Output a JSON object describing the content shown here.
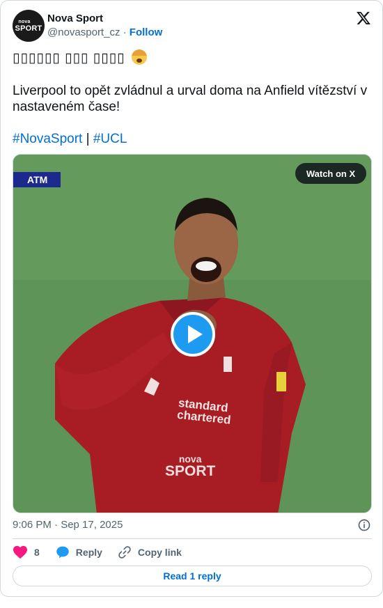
{
  "header": {
    "name": "Nova Sport",
    "handle": "@novasport_cz",
    "separator": "·",
    "follow_label": "Follow",
    "avatar_text_top": "nova",
    "avatar_text_bottom": "SPORT"
  },
  "tweet": {
    "emoji_text": "▯▯▯▯▯▯ ▯▯▯ ▯▯▯▯",
    "emoji_icon": "exploding-head-emoji",
    "body": "Liverpool to opět zvládnul a urval doma na Anfield vítězství v nastaveném čase!",
    "hashtags": [
      "#NovaSport",
      "#UCL"
    ],
    "hashtag_separator": "|"
  },
  "media": {
    "watch_label": "Watch on X",
    "scoreboard_text": "ATM",
    "watermark_top": "nova",
    "watermark_bottom": "SPORT",
    "shirt_sponsor": "standard chartered"
  },
  "footer": {
    "timestamp": "9:06 PM · Sep 17, 2025",
    "like_count": "8",
    "reply_label": "Reply",
    "copy_label": "Copy link",
    "read_replies_label": "Read 1 reply"
  },
  "colors": {
    "accent": "#006fd6",
    "play_button": "#1d9bf0",
    "like_heart": "#f91880",
    "reply_bubble": "#1d9bf0",
    "muted": "#536471",
    "border": "#cfd9de"
  },
  "icons": {
    "logo": "x-logo-icon",
    "info": "info-icon",
    "like": "heart-icon",
    "reply": "reply-bubble-icon",
    "copy": "link-icon",
    "play": "play-icon"
  }
}
